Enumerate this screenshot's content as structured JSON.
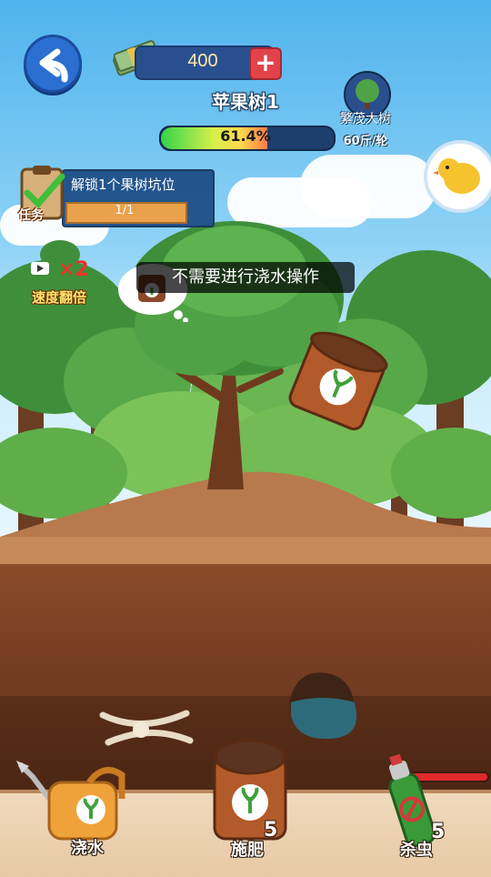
{
  "header": {
    "currency_value": "400",
    "tree_name": "苹果树1",
    "growth_progress_text": "61.4%",
    "growth_progress": 0.614,
    "next_stage_name": "繁茂大树",
    "next_stage_yield": "60斤/轮"
  },
  "task": {
    "badge": "任务",
    "title": "解锁1个果树坑位",
    "progress_text": "1/1"
  },
  "boost": {
    "multiplier": "×2",
    "label": "速度翻倍"
  },
  "toast": {
    "message": "不需要进行浇水操作"
  },
  "tools": {
    "water": {
      "label": "浇水"
    },
    "fertilize": {
      "label": "施肥",
      "count": "5"
    },
    "pesticide": {
      "label": "杀虫",
      "count": "5"
    }
  },
  "icons": {
    "back": "back-arrow-icon",
    "currency": "cash-stack-icon",
    "add": "plus-icon",
    "stage": "tree-icon",
    "bird": "chick-icon",
    "task": "clipboard-check-icon",
    "video": "video-icon",
    "fertilizer": "fertilizer-bag-icon",
    "watering": "watering-can-icon",
    "spray": "spray-can-icon"
  },
  "colors": {
    "panel": "#1f4f88",
    "accent": "#2b6fd1",
    "add": "#e2434b",
    "task_bar": "#e9a24b",
    "pest_bar": "#e02a2a"
  }
}
